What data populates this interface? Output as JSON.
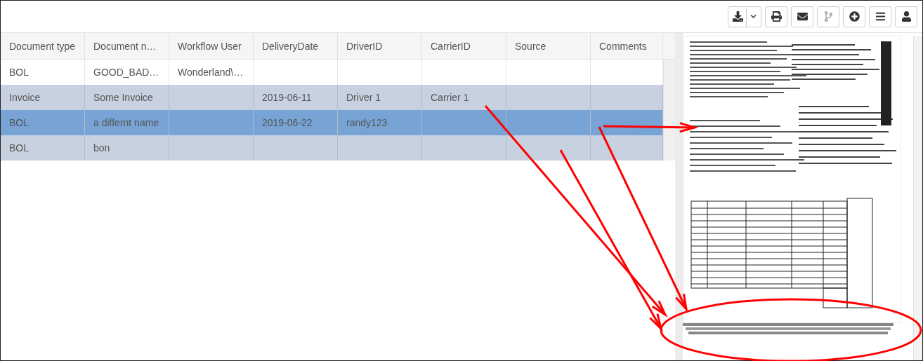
{
  "toolbar": [
    {
      "kind": "download",
      "disabled": false,
      "dropdown": true
    },
    {
      "kind": "print",
      "disabled": false,
      "dropdown": false
    },
    {
      "kind": "email",
      "disabled": false,
      "dropdown": false
    },
    {
      "kind": "branch",
      "disabled": true,
      "dropdown": false
    },
    {
      "kind": "add",
      "disabled": false,
      "dropdown": false
    },
    {
      "kind": "menu",
      "disabled": false,
      "dropdown": false
    },
    {
      "kind": "user",
      "disabled": false,
      "dropdown": false
    }
  ],
  "table": {
    "columns": [
      "Document type",
      "Document n…",
      "Workflow User",
      "DeliveryDate",
      "DriverID",
      "CarrierID",
      "Source",
      "Comments"
    ],
    "rows": [
      {
        "selected": false,
        "current": false,
        "cells": [
          "BOL",
          "GOOD_BAD…",
          "Wonderland\\…",
          null,
          null,
          null,
          null,
          null
        ]
      },
      {
        "selected": true,
        "current": false,
        "cells": [
          "Invoice",
          "Some Invoice",
          null,
          "2019-06-11",
          "Driver 1",
          "Carrier 1",
          null,
          null
        ]
      },
      {
        "selected": true,
        "current": true,
        "cells": [
          "BOL",
          "a differnt name",
          null,
          "2019-06-22",
          "randy123",
          null,
          null,
          null
        ]
      },
      {
        "selected": true,
        "current": false,
        "cells": [
          "BOL",
          "bon",
          null,
          null,
          null,
          null,
          null,
          null
        ]
      }
    ]
  }
}
